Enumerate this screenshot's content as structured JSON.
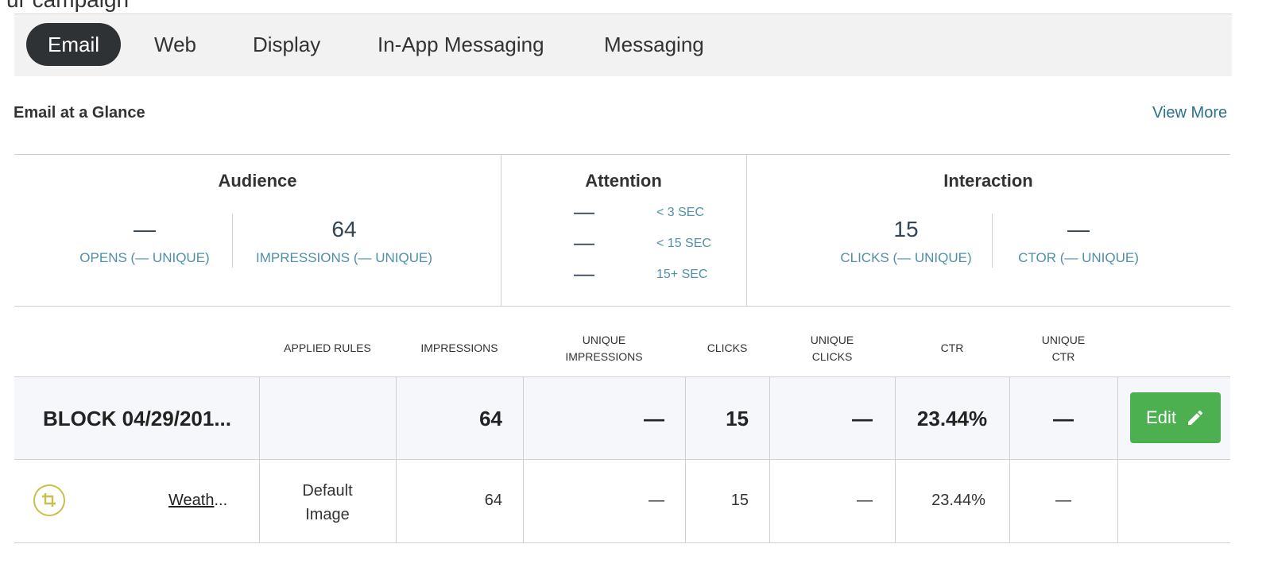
{
  "top_fragment": "ur campaign",
  "tabs": [
    {
      "label": "Email",
      "active": true
    },
    {
      "label": "Web",
      "active": false
    },
    {
      "label": "Display",
      "active": false
    },
    {
      "label": "In-App Messaging",
      "active": false
    },
    {
      "label": "Messaging",
      "active": false
    }
  ],
  "section_title": "Email at a Glance",
  "view_more": "View More",
  "summary": {
    "audience": {
      "title": "Audience",
      "opens_value": "—",
      "opens_label": "OPENS (— UNIQUE)",
      "impressions_value": "64",
      "impressions_label": "IMPRESSIONS (— UNIQUE)"
    },
    "attention": {
      "title": "Attention",
      "rows": [
        {
          "value": "—",
          "label": "< 3 SEC"
        },
        {
          "value": "—",
          "label": "< 15 SEC"
        },
        {
          "value": "—",
          "label": "15+ SEC"
        }
      ]
    },
    "interaction": {
      "title": "Interaction",
      "clicks_value": "15",
      "clicks_label": "CLICKS (— UNIQUE)",
      "ctor_value": "—",
      "ctor_label": "CTOR (— UNIQUE)"
    }
  },
  "table": {
    "headers": {
      "applied_rules": "APPLIED RULES",
      "impressions": "IMPRESSIONS",
      "unique_impressions_1": "UNIQUE",
      "unique_impressions_2": "IMPRESSIONS",
      "clicks": "CLICKS",
      "unique_clicks_1": "UNIQUE",
      "unique_clicks_2": "CLICKS",
      "ctr": "CTR",
      "unique_ctr_1": "UNIQUE",
      "unique_ctr_2": "CTR"
    },
    "block_row": {
      "name": "BLOCK 04/29/201...",
      "applied_rules": "",
      "impressions": "64",
      "unique_impressions": "—",
      "clicks": "15",
      "unique_clicks": "—",
      "ctr": "23.44%",
      "unique_ctr": "—",
      "edit_label": "Edit"
    },
    "sub_row": {
      "icon": "crop-icon",
      "name_visible": "Weath",
      "name_ellipsis": "...",
      "applied_rules_1": "Default",
      "applied_rules_2": "Image",
      "impressions": "64",
      "unique_impressions": "—",
      "clicks": "15",
      "unique_clicks": "—",
      "ctr": "23.44%",
      "unique_ctr": "—"
    }
  },
  "colors": {
    "active_tab_bg": "#2e3235",
    "link": "#2b6f8e",
    "metric_label": "#4f8fa8",
    "edit_button": "#4caf50",
    "crop_icon": "#c8c04a"
  }
}
